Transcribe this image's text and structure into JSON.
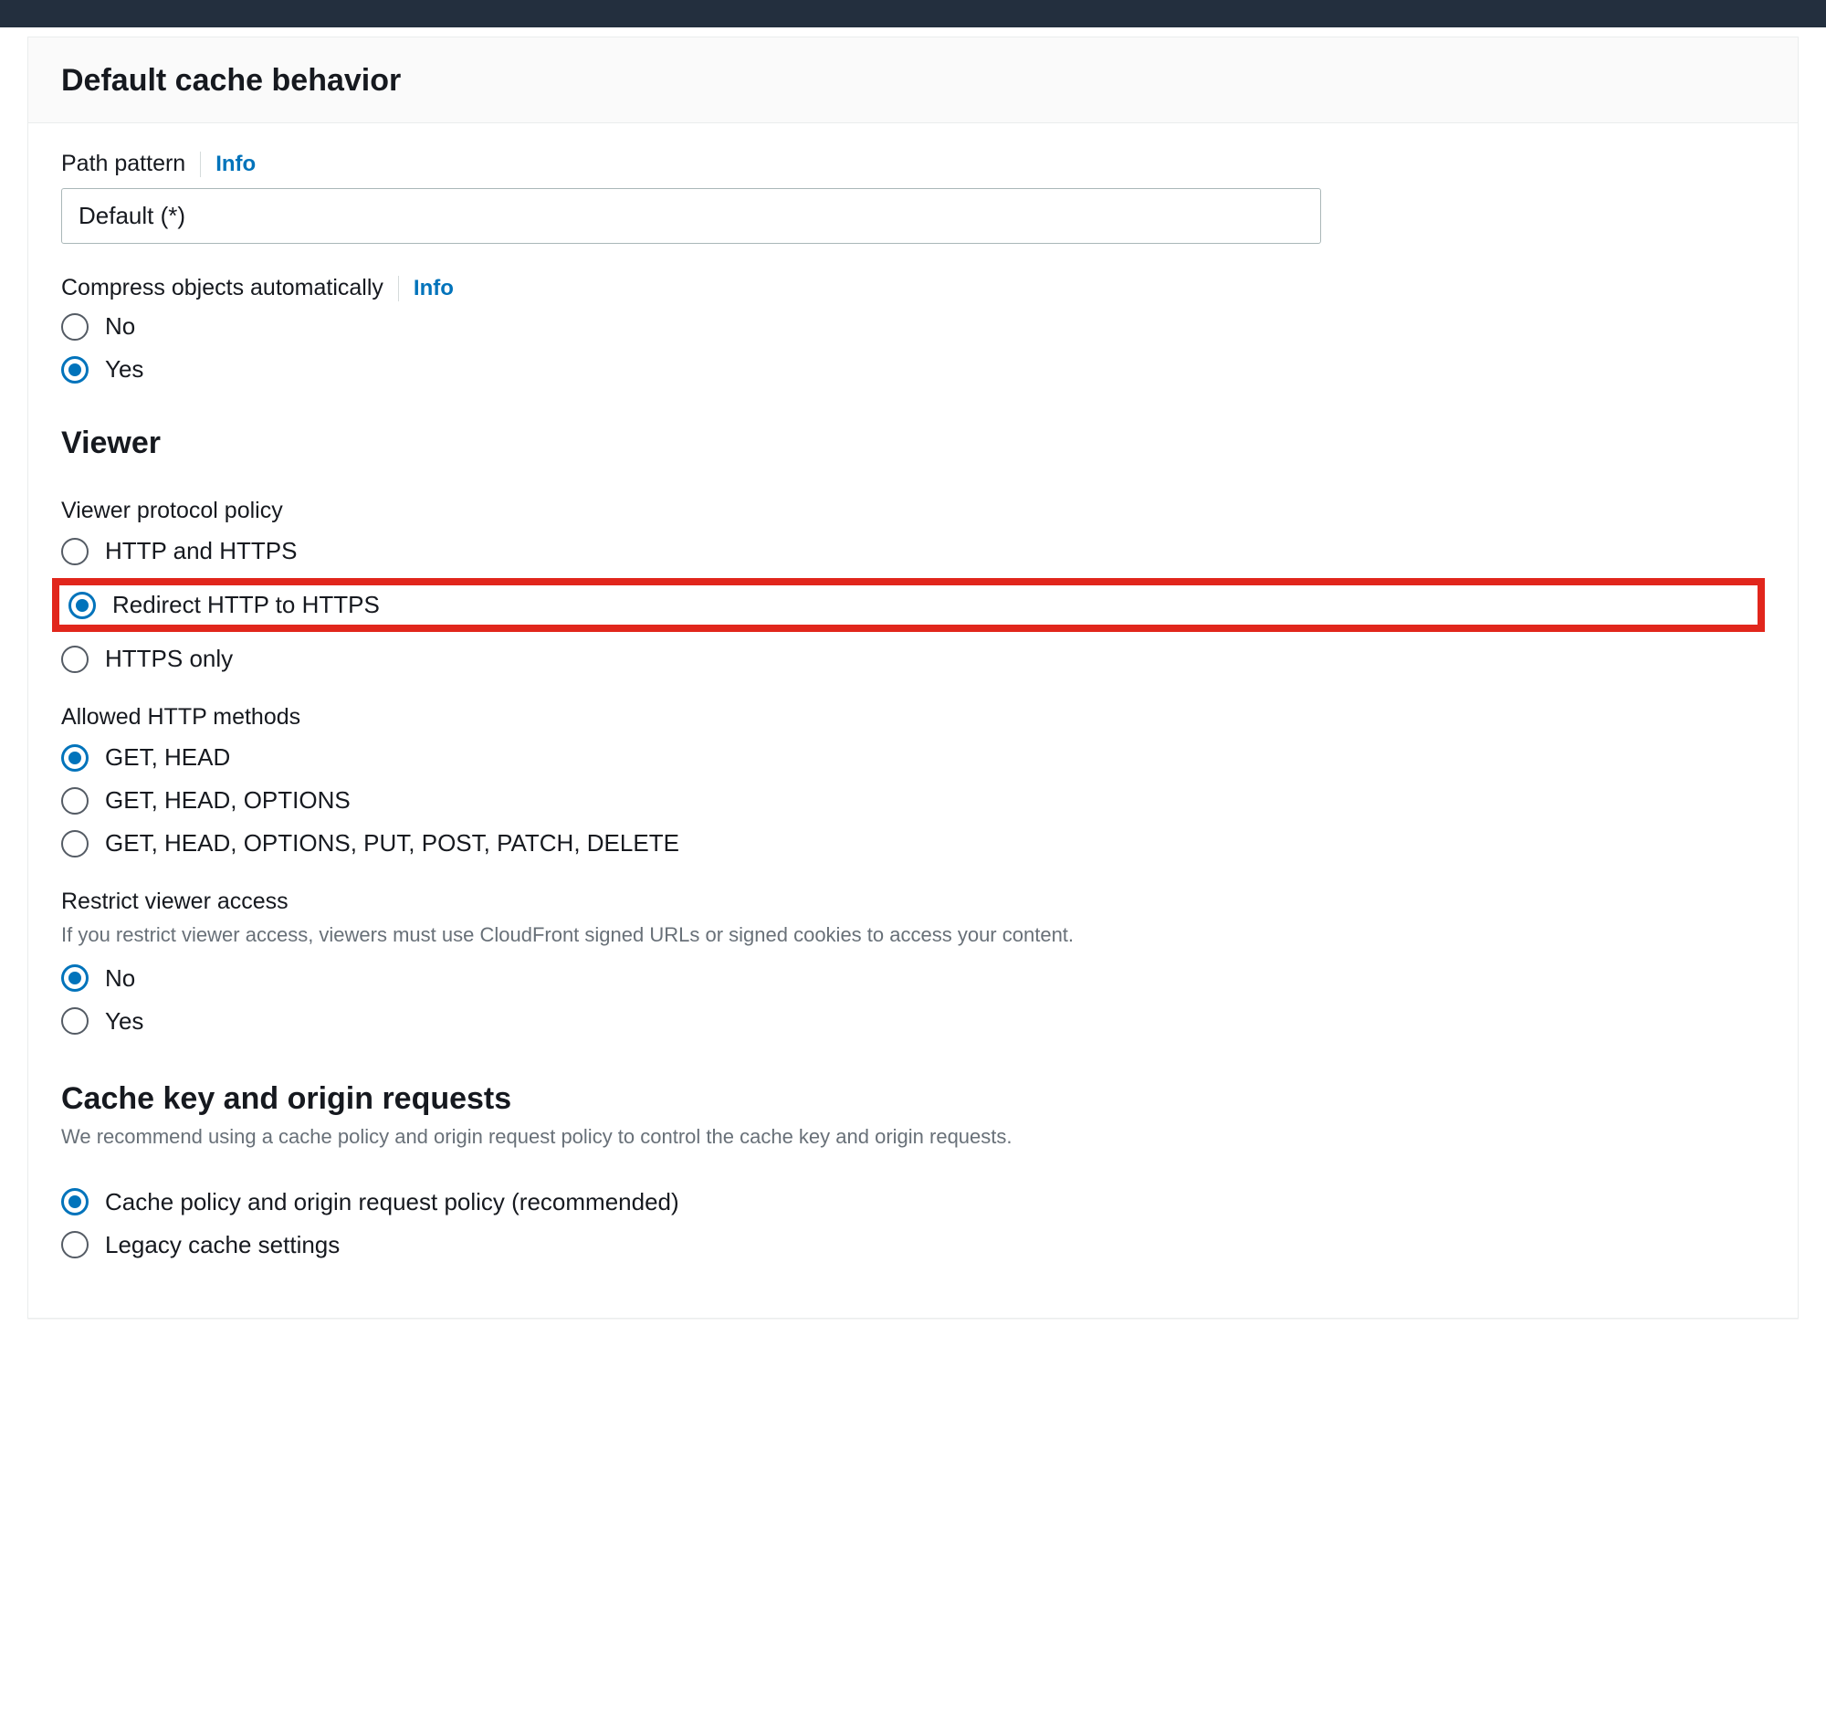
{
  "card": {
    "title": "Default cache behavior"
  },
  "pathPattern": {
    "label": "Path pattern",
    "info": "Info",
    "value": "Default (*)"
  },
  "compress": {
    "label": "Compress objects automatically",
    "info": "Info",
    "options": {
      "no": "No",
      "yes": "Yes"
    },
    "selected": "yes"
  },
  "viewerSection": {
    "heading": "Viewer"
  },
  "viewerProtocol": {
    "label": "Viewer protocol policy",
    "options": {
      "both": "HTTP and HTTPS",
      "redirect": "Redirect HTTP to HTTPS",
      "httpsOnly": "HTTPS only"
    },
    "selected": "redirect"
  },
  "allowedMethods": {
    "label": "Allowed HTTP methods",
    "options": {
      "getHead": "GET, HEAD",
      "getHeadOptions": "GET, HEAD, OPTIONS",
      "all": "GET, HEAD, OPTIONS, PUT, POST, PATCH, DELETE"
    },
    "selected": "getHead"
  },
  "restrictAccess": {
    "label": "Restrict viewer access",
    "help": "If you restrict viewer access, viewers must use CloudFront signed URLs or signed cookies to access your content.",
    "options": {
      "no": "No",
      "yes": "Yes"
    },
    "selected": "no"
  },
  "cacheKeySection": {
    "heading": "Cache key and origin requests",
    "help": "We recommend using a cache policy and origin request policy to control the cache key and origin requests."
  },
  "cacheKeyMode": {
    "options": {
      "policy": "Cache policy and origin request policy (recommended)",
      "legacy": "Legacy cache settings"
    },
    "selected": "policy"
  }
}
